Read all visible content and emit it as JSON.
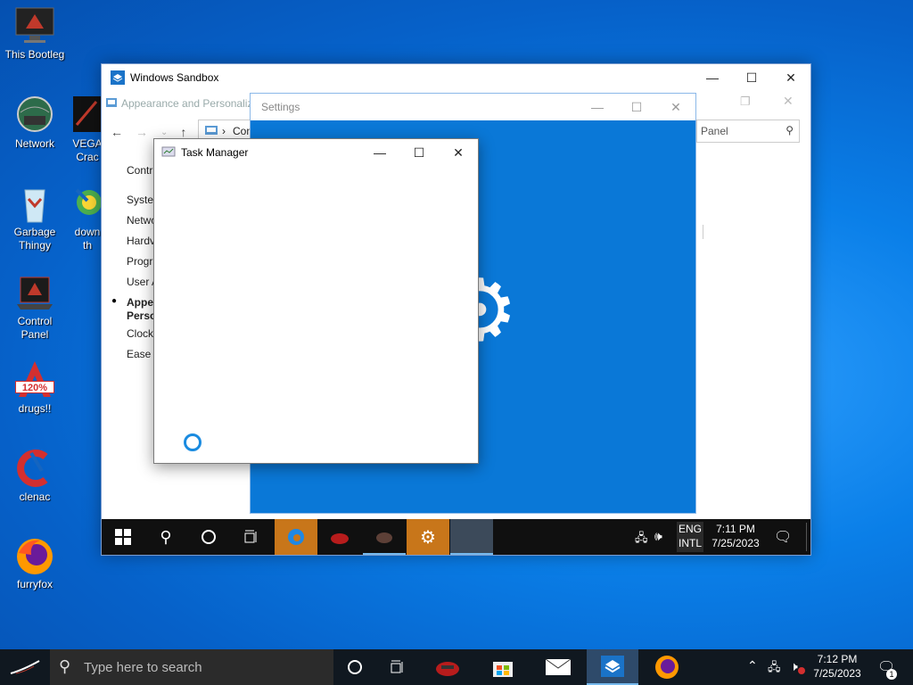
{
  "desktop": {
    "icons": [
      {
        "label": "This Bootleg"
      },
      {
        "label": "Network"
      },
      {
        "label": "Garbage\nThingy"
      },
      {
        "label": "Control\nPanel"
      },
      {
        "label": "drugs!!"
      },
      {
        "label": "clenac"
      },
      {
        "label": "furryfox"
      },
      {
        "label": "VEGA\nCrac"
      },
      {
        "label": "down\nth"
      }
    ],
    "drugs_badge": "120%"
  },
  "sandbox": {
    "title": "Windows Sandbox",
    "controls": {
      "minimize": "—",
      "maximize": "☐",
      "close": "✕"
    },
    "control_panel": {
      "title": "Appearance and Personaliza",
      "address": "Con",
      "search_placeholder": "Panel",
      "side_items": [
        "Contr",
        "Syster",
        "Netwo",
        "Hardv",
        "Progr",
        "User A",
        "Appea\nPerso",
        "Clock",
        "Ease c"
      ]
    },
    "taskbar": {
      "lang_top": "ENG",
      "lang_bottom": "INTL",
      "time": "7:11 PM",
      "date": "7/25/2023"
    }
  },
  "settings": {
    "title": "Settings"
  },
  "task_manager": {
    "title": "Task Manager"
  },
  "host_taskbar": {
    "search_placeholder": "Type here to search",
    "time": "7:12 PM",
    "date": "7/25/2023",
    "notification_count": "1"
  },
  "colors": {
    "accent": "#0078d7",
    "settings_bg": "#0a78d7",
    "highlight_orange": "#c8761a"
  }
}
